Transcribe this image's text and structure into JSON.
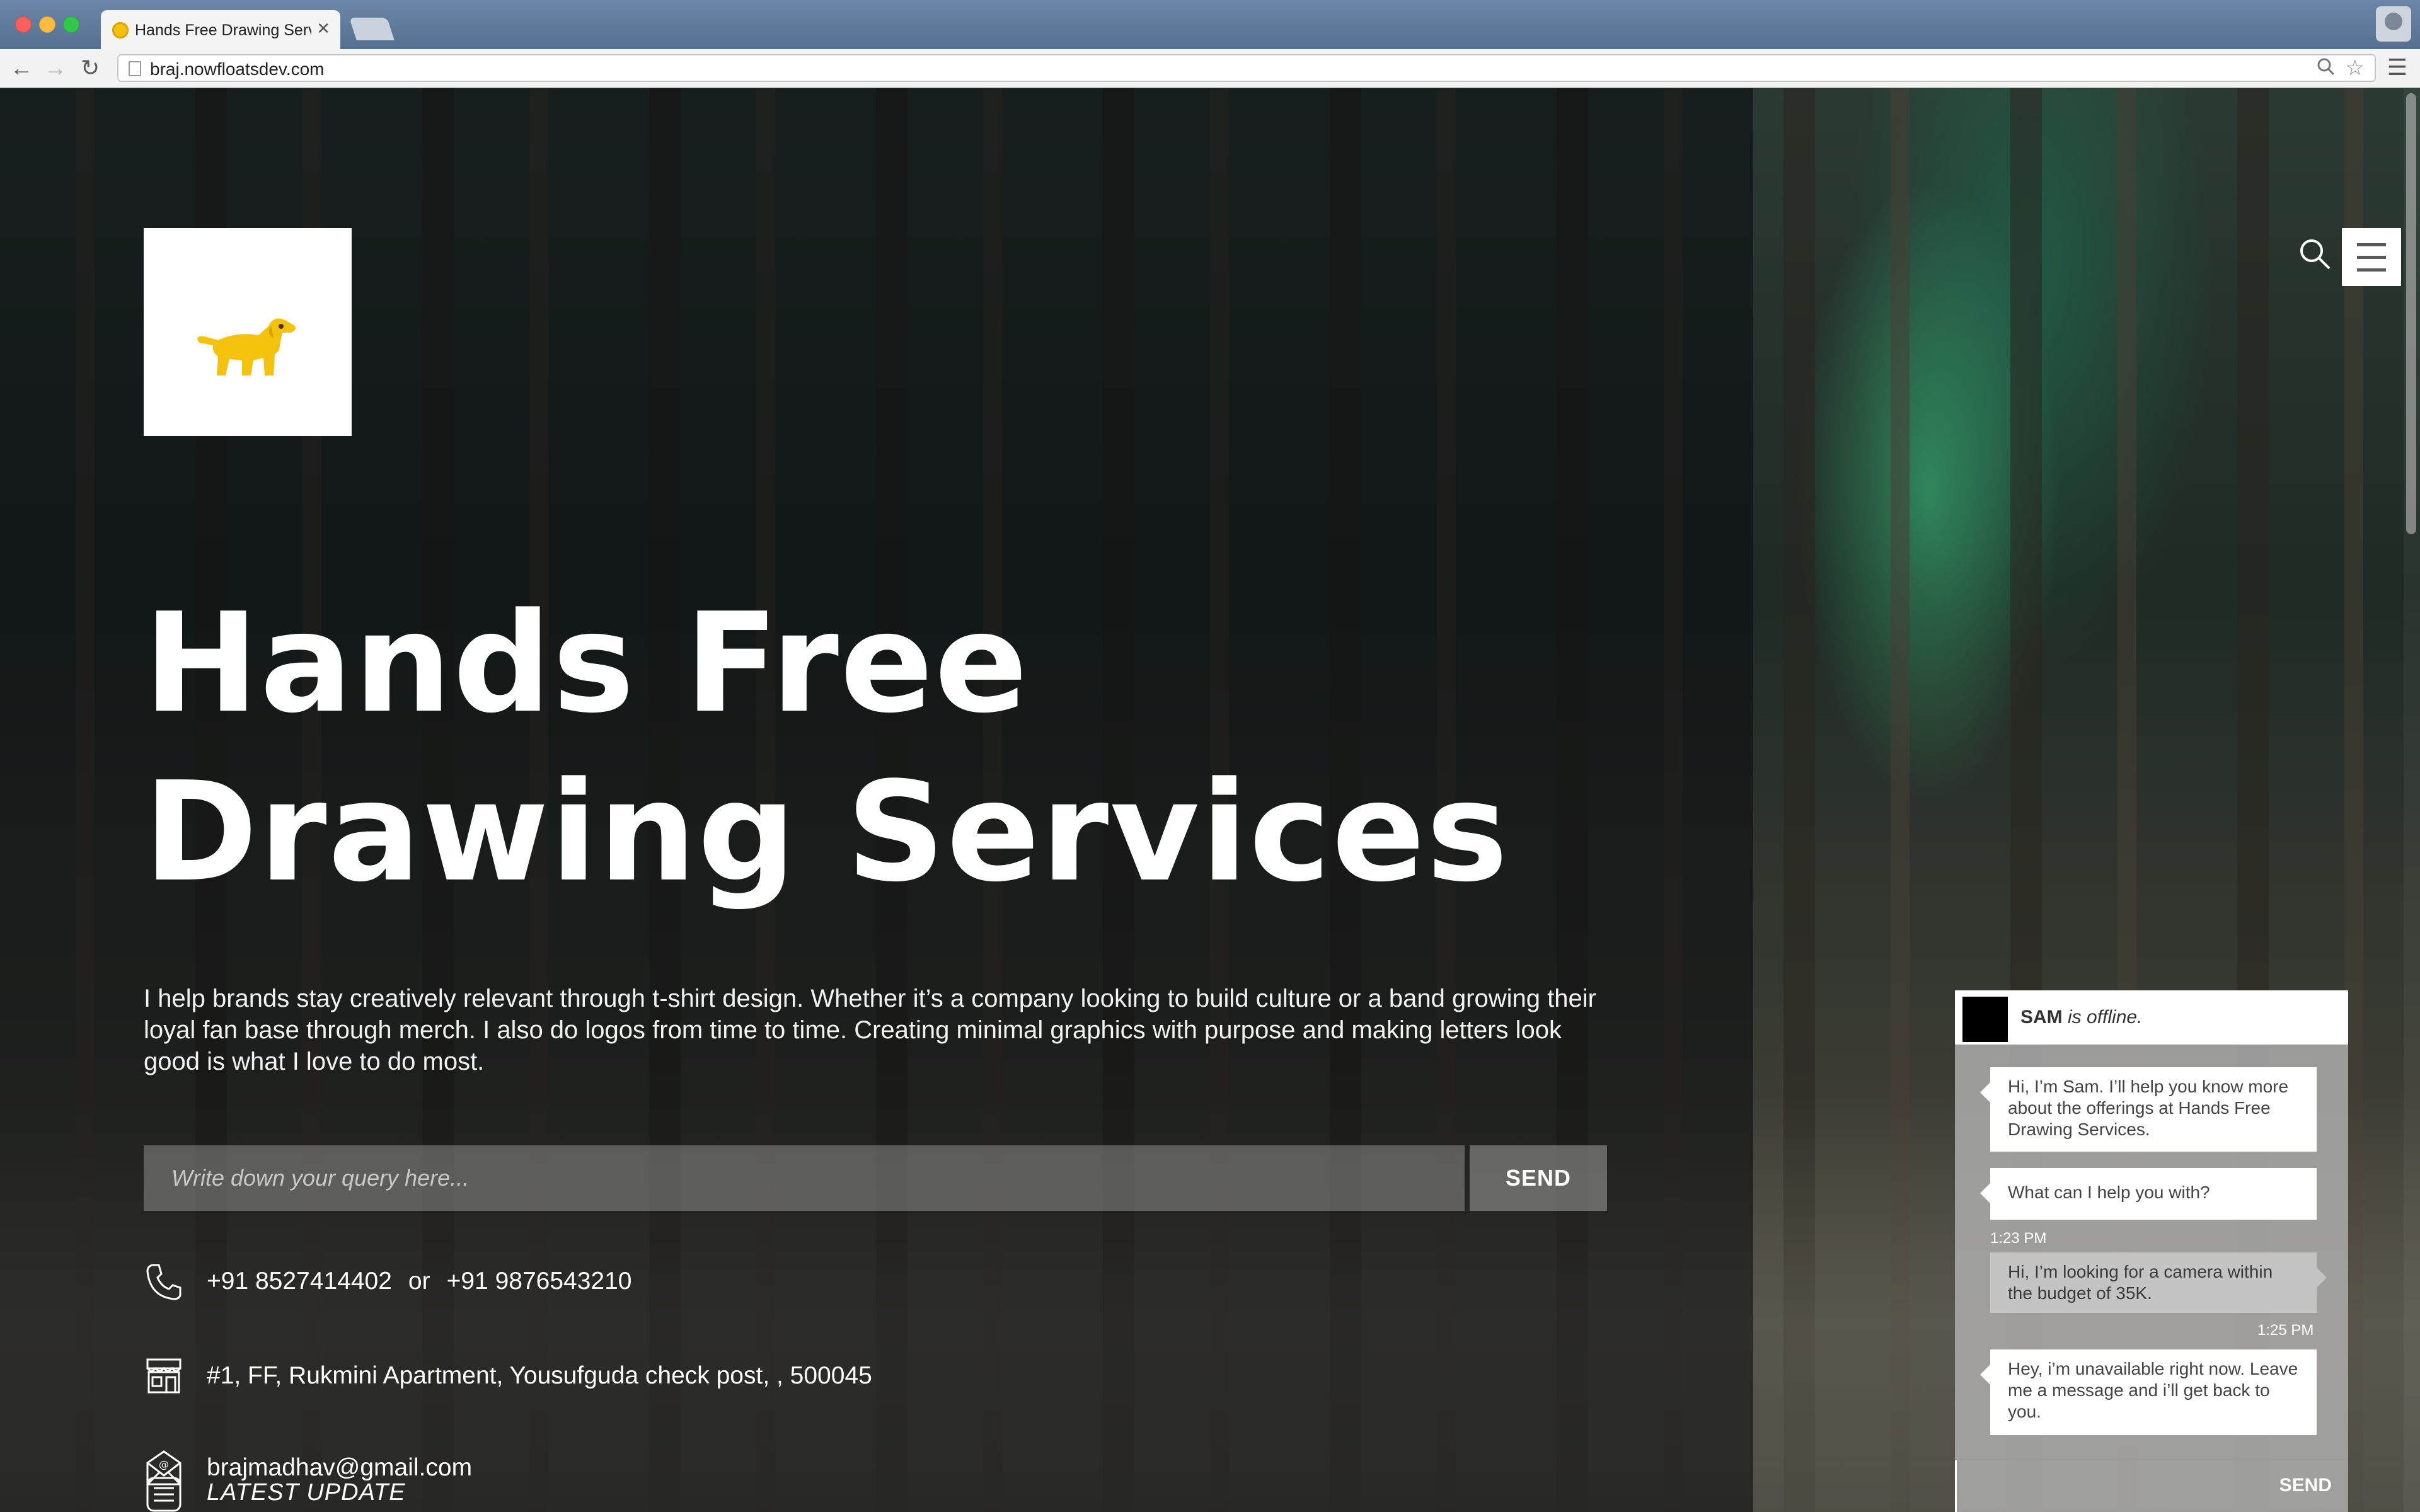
{
  "browser": {
    "tab_title": "Hands Free Drawing Servic",
    "url": "braj.nowfloatsdev.com"
  },
  "page": {
    "title": "Hands Free Drawing Services",
    "description": "I help brands stay creatively relevant through t-shirt design. Whether it’s a company looking to build culture or a band growing their loyal fan base through merch. I also do logos from time to time. Creating minimal graphics with purpose and making letters look good is what I love to do most.",
    "query": {
      "placeholder": "Write down your query here...",
      "value": "",
      "send_label": "SEND"
    },
    "contact": {
      "phone_primary": "+91 8527414402",
      "or_label": "or",
      "phone_secondary": "+91 9876543210",
      "address": "#1, FF, Rukmini Apartment, Yousufguda check post, , 500045",
      "email": "brajmadhav@gmail.com"
    },
    "latest_update_label": "LATEST UPDATE"
  },
  "chat": {
    "agent_name": "SAM",
    "status_text": " is offline.",
    "messages": [
      {
        "from": "agent",
        "text": "Hi, I’m Sam. I’ll help you know more about the offerings at Hands Free Drawing Services."
      },
      {
        "from": "agent",
        "text": "What can I help you with?",
        "time": "1:23 PM"
      },
      {
        "from": "user",
        "text": "Hi, I’m looking for a camera within the budget of 35K.",
        "time": "1:25 PM"
      },
      {
        "from": "agent",
        "text": "Hey, i’m unavailable right now. Leave me a message and i’ll get back to you."
      }
    ],
    "input_value": "",
    "send_label": "SEND"
  },
  "colors": {
    "tabbar": "#55708f",
    "logo_dog": "#f4c20d",
    "chat_panel": "#aaaaaa"
  },
  "icons": [
    "back-icon",
    "forward-icon",
    "reload-icon",
    "page-icon",
    "zoom-icon",
    "bookmark-star-icon",
    "chrome-menu-icon",
    "search-icon",
    "hamburger-menu-icon",
    "phone-icon",
    "store-icon",
    "email-icon",
    "news-icon",
    "dog-logo-icon"
  ]
}
